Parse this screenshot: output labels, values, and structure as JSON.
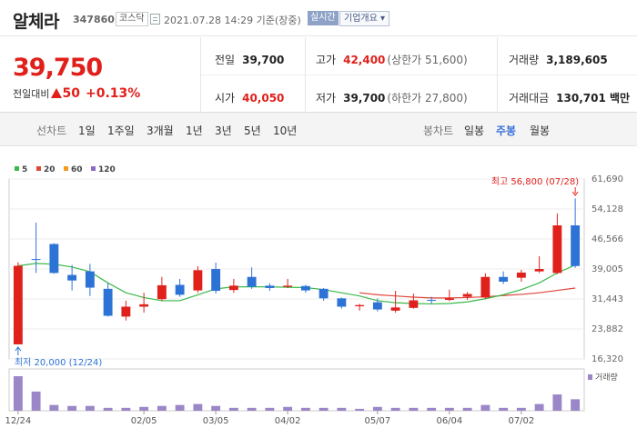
{
  "header": {
    "stock_name": "알체라",
    "stock_code": "347860",
    "market": "코스닥",
    "datetime": "2021.07.28 14:29 기준(장중)",
    "realtime_label": "실시간",
    "company_button": "기업개요 ▾"
  },
  "price": {
    "current": "39,750",
    "change_label": "전일대비",
    "change_value": "50",
    "change_rate": "+0.13%",
    "direction": "up"
  },
  "stats": {
    "prev_close_label": "전일",
    "prev_close": "39,700",
    "open_label": "시가",
    "open": "40,050",
    "high_label": "고가",
    "high": "42,400",
    "upper_limit": "(상한가 51,600)",
    "low_label": "저가",
    "low": "39,700",
    "lower_limit": "(하한가 27,800)",
    "volume_label": "거래량",
    "volume": "3,189,605",
    "amount_label": "거래대금",
    "amount": "130,701 백만"
  },
  "period_bar": {
    "line_chart_label": "선차트",
    "periods": [
      "1일",
      "1주일",
      "3개월",
      "1년",
      "3년",
      "5년",
      "10년"
    ],
    "candle_chart_label": "봉차트",
    "candles": [
      "일봉",
      "주봉",
      "월봉"
    ],
    "active_candle": "주봉"
  },
  "colors": {
    "up": "#e0201b",
    "down": "#2d73d6",
    "ma5": "#3ab94a",
    "ma20": "#e0453a",
    "ma60": "#f39a1d",
    "ma120": "#8a6bc3",
    "volume": "#9b86c7"
  },
  "chart_data": {
    "type": "candlestick",
    "legend": [
      {
        "name": "5",
        "color": "#3ab94a"
      },
      {
        "name": "20",
        "color": "#e0453a"
      },
      {
        "name": "60",
        "color": "#f39a1d"
      },
      {
        "name": "120",
        "color": "#8a6bc3"
      }
    ],
    "y_ticks": [
      "61,690",
      "54,128",
      "46,566",
      "39,005",
      "31,443",
      "23,882",
      "16,320"
    ],
    "ylim": [
      16320,
      61690
    ],
    "x_ticks": [
      {
        "label": "12/24",
        "index": 0
      },
      {
        "label": "02/05",
        "index": 7
      },
      {
        "label": "03/05",
        "index": 11
      },
      {
        "label": "04/02",
        "index": 15
      },
      {
        "label": "05/07",
        "index": 20
      },
      {
        "label": "06/04",
        "index": 24
      },
      {
        "label": "07/02",
        "index": 28
      }
    ],
    "high_annotation": "최고 56,800 (07/28)",
    "low_annotation": "최저 20,000 (12/24)",
    "volume_label": "거래량",
    "candles": [
      {
        "o": 20000,
        "c": 39800,
        "h": 40700,
        "l": 20000
      },
      {
        "o": 41500,
        "c": 41400,
        "h": 50700,
        "l": 38000
      },
      {
        "o": 45300,
        "c": 38000,
        "h": 45500,
        "l": 37800
      },
      {
        "o": 37500,
        "c": 36100,
        "h": 40000,
        "l": 33600
      },
      {
        "o": 38400,
        "c": 34300,
        "h": 40300,
        "l": 32200
      },
      {
        "o": 34000,
        "c": 27200,
        "h": 35500,
        "l": 27000
      },
      {
        "o": 27000,
        "c": 29500,
        "h": 31000,
        "l": 26000
      },
      {
        "o": 29500,
        "c": 30100,
        "h": 33000,
        "l": 28000
      },
      {
        "o": 31400,
        "c": 34900,
        "h": 37000,
        "l": 31000
      },
      {
        "o": 35000,
        "c": 32500,
        "h": 36500,
        "l": 32000
      },
      {
        "o": 33600,
        "c": 38700,
        "h": 39700,
        "l": 33000
      },
      {
        "o": 39000,
        "c": 33500,
        "h": 40600,
        "l": 32800
      },
      {
        "o": 33700,
        "c": 34800,
        "h": 36500,
        "l": 33000
      },
      {
        "o": 37000,
        "c": 34500,
        "h": 39400,
        "l": 34000
      },
      {
        "o": 34800,
        "c": 34200,
        "h": 35400,
        "l": 33500
      },
      {
        "o": 34500,
        "c": 34800,
        "h": 36500,
        "l": 34200
      },
      {
        "o": 34700,
        "c": 33600,
        "h": 35000,
        "l": 33000
      },
      {
        "o": 34000,
        "c": 31600,
        "h": 34200,
        "l": 31000
      },
      {
        "o": 31600,
        "c": 29500,
        "h": 31800,
        "l": 29000
      },
      {
        "o": 29600,
        "c": 29900,
        "h": 30200,
        "l": 28500
      },
      {
        "o": 30600,
        "c": 28800,
        "h": 31600,
        "l": 28300
      },
      {
        "o": 28500,
        "c": 29300,
        "h": 33500,
        "l": 28000
      },
      {
        "o": 29200,
        "c": 31100,
        "h": 32800,
        "l": 29000
      },
      {
        "o": 31200,
        "c": 31000,
        "h": 32000,
        "l": 30300
      },
      {
        "o": 31200,
        "c": 31600,
        "h": 33800,
        "l": 30900
      },
      {
        "o": 32000,
        "c": 32700,
        "h": 33200,
        "l": 31200
      },
      {
        "o": 31800,
        "c": 37000,
        "h": 37900,
        "l": 31500
      },
      {
        "o": 37000,
        "c": 35800,
        "h": 38400,
        "l": 35200
      },
      {
        "o": 36800,
        "c": 38100,
        "h": 38800,
        "l": 35800
      },
      {
        "o": 38400,
        "c": 39000,
        "h": 42200,
        "l": 38000
      },
      {
        "o": 38000,
        "c": 50000,
        "h": 53000,
        "l": 37700
      },
      {
        "o": 50000,
        "c": 39750,
        "h": 56800,
        "l": 39300
      }
    ],
    "ma5": [
      39800,
      40400,
      40200,
      39500,
      38300,
      35500,
      33000,
      31800,
      31000,
      31000,
      32500,
      34000,
      34500,
      34500,
      34500,
      34400,
      34300,
      33800,
      33000,
      32200,
      31000,
      30500,
      30300,
      30200,
      30300,
      30700,
      31500,
      32500,
      33800,
      35500,
      38000,
      40000
    ],
    "ma20": [
      null,
      null,
      null,
      null,
      null,
      null,
      null,
      null,
      null,
      null,
      null,
      null,
      null,
      null,
      null,
      null,
      null,
      null,
      null,
      33000,
      32500,
      32200,
      31900,
      31700,
      31700,
      31800,
      32000,
      32300,
      32600,
      33000,
      33600,
      34200
    ],
    "volumes": [
      36,
      20,
      6,
      5,
      5,
      3,
      3,
      4,
      5,
      6,
      7,
      5,
      3,
      3,
      3,
      4,
      3,
      3,
      3,
      2,
      4,
      3,
      3,
      3,
      3,
      3,
      6,
      3,
      3,
      7,
      17,
      12
    ]
  }
}
